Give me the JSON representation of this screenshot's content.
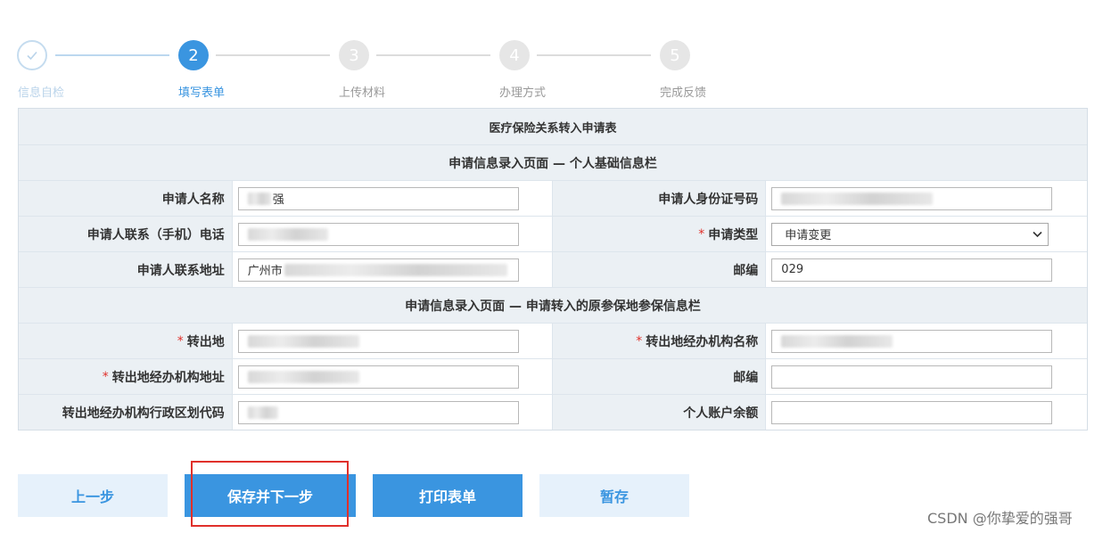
{
  "steps": [
    {
      "label": "信息自检",
      "number": "✓",
      "state": "done"
    },
    {
      "label": "填写表单",
      "number": "2",
      "state": "active"
    },
    {
      "label": "上传材料",
      "number": "3",
      "state": "pending"
    },
    {
      "label": "办理方式",
      "number": "4",
      "state": "pending"
    },
    {
      "label": "完成反馈",
      "number": "5",
      "state": "pending"
    }
  ],
  "form": {
    "title": "医疗保险关系转入申请表",
    "section1": "申请信息录入页面 — 个人基础信息栏",
    "section2": "申请信息录入页面 — 申请转入的原参保地参保信息栏",
    "applicant_name_label": "申请人名称",
    "applicant_name_value": "强",
    "applicant_id_label": "申请人身份证号码",
    "applicant_phone_label": "申请人联系（手机）电话",
    "apply_type_label": "申请类型",
    "apply_type_value": "申请变更",
    "applicant_address_label": "申请人联系地址",
    "applicant_address_value": "广州市",
    "postcode_label": "邮编",
    "postcode_value": "029",
    "transfer_from_label": "转出地",
    "transfer_agency_name_label": "转出地经办机构名称",
    "transfer_agency_address_label": "转出地经办机构地址",
    "postcode2_label": "邮编",
    "region_code_label": "转出地经办机构行政区划代码",
    "balance_label": "个人账户余额",
    "required_mark": "*"
  },
  "buttons": {
    "prev": "上一步",
    "save_next": "保存并下一步",
    "print": "打印表单",
    "hold": "暂存"
  },
  "watermark": "CSDN @你挚爱的强哥",
  "colors": {
    "accent": "#3a95e0",
    "header_bg": "#ebf0f4",
    "highlight": "#e0302a"
  }
}
